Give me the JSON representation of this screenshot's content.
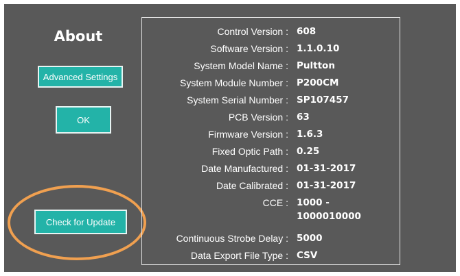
{
  "about": {
    "title": "About",
    "buttons": {
      "advanced_settings": "Advanced Settings",
      "ok": "OK",
      "check_for_update": "Check for Update"
    },
    "highlight_color": "#f0a050",
    "accent_color": "#23b3a8",
    "background_color": "#595959"
  },
  "info": {
    "control_version": {
      "label": "Control Version :",
      "value": "608"
    },
    "software_version": {
      "label": "Software Version :",
      "value": "1.1.0.10"
    },
    "system_model_name": {
      "label": "System Model Name :",
      "value": "Pultton"
    },
    "system_module_number": {
      "label": "System Module Number :",
      "value": "P200CM"
    },
    "system_serial_number": {
      "label": "System Serial Number :",
      "value": "SP107457"
    },
    "pcb_version": {
      "label": "PCB Version :",
      "value": "63"
    },
    "firmware_version": {
      "label": "Firmware Version :",
      "value": "1.6.3"
    },
    "fixed_optic_path": {
      "label": "Fixed Optic Path :",
      "value": "0.25"
    },
    "date_manufactured": {
      "label": "Date Manufactured :",
      "value": "01-31-2017"
    },
    "date_calibrated": {
      "label": "Date Calibrated :",
      "value": "01-31-2017"
    },
    "cce": {
      "label": "CCE :",
      "value": "1000 -\n1000010000"
    },
    "continuous_strobe_delay": {
      "label": "Continuous Strobe Delay :",
      "value": "5000"
    },
    "data_export_file_type": {
      "label": "Data Export File Type :",
      "value": "CSV"
    }
  }
}
